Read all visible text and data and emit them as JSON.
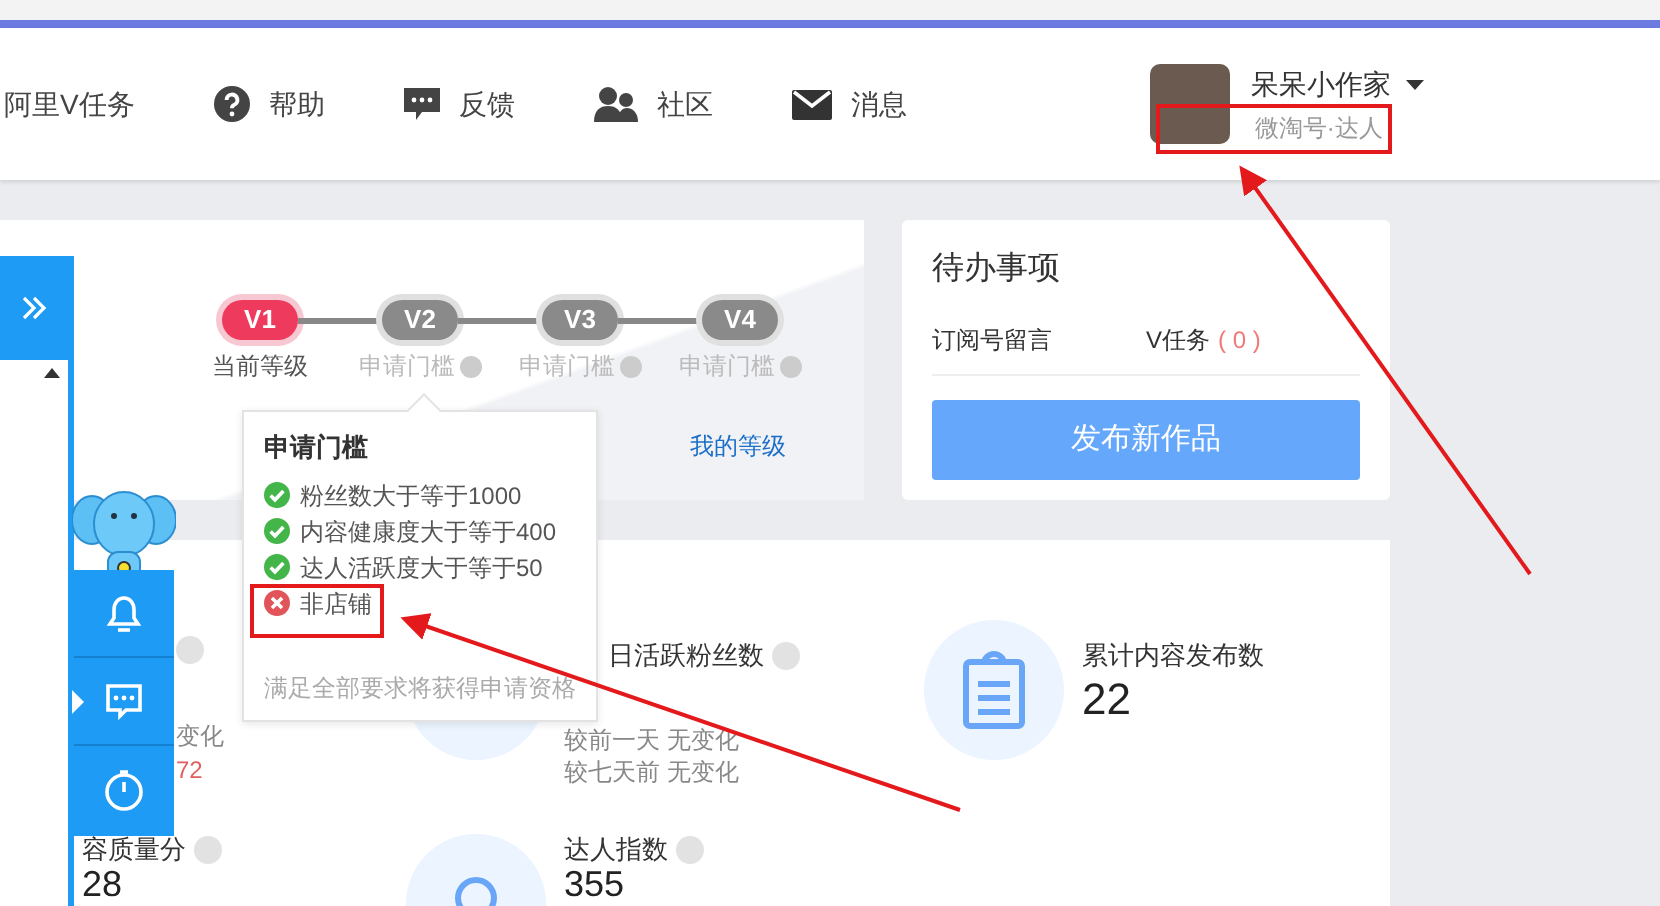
{
  "nav": {
    "items": [
      {
        "label": "阿里V任务"
      },
      {
        "label": "帮助"
      },
      {
        "label": "反馈"
      },
      {
        "label": "社区"
      },
      {
        "label": "消息"
      }
    ]
  },
  "user": {
    "name": "呆呆小作家",
    "role": "微淘号·达人"
  },
  "levels": {
    "steps": [
      {
        "badge": "V1",
        "label": "当前等级",
        "current": true
      },
      {
        "badge": "V2",
        "label": "申请门槛",
        "current": false
      },
      {
        "badge": "V3",
        "label": "申请门槛",
        "current": false
      },
      {
        "badge": "V4",
        "label": "申请门槛",
        "current": false
      }
    ],
    "link": "我的等级"
  },
  "popup": {
    "title": "申请门槛",
    "requirements": [
      {
        "text": "粉丝数大于等于1000",
        "met": true
      },
      {
        "text": "内容健康度大于等于400",
        "met": true
      },
      {
        "text": "达人活跃度大于等于50",
        "met": true
      },
      {
        "text": "非店铺",
        "met": false
      }
    ],
    "note": "满足全部要求将获得申请资格"
  },
  "todo": {
    "title": "待办事项",
    "items": [
      {
        "label": "订阅号留言"
      },
      {
        "label": "V任务",
        "count": "( 0 )"
      }
    ],
    "button": "发布新作品"
  },
  "stats": [
    {
      "kind": "clipped",
      "help": true,
      "lines": [
        "变化"
      ],
      "delta": "72"
    },
    {
      "kind": "full",
      "label": "日活跃粉丝数",
      "help": true,
      "lines": [
        "较前一天 无变化",
        "较七天前 无变化"
      ]
    },
    {
      "kind": "full",
      "label": "累计内容发布数",
      "help": false,
      "value": "22"
    },
    {
      "kind": "clipped",
      "label": "容质量分",
      "help": true,
      "value": "28"
    },
    {
      "kind": "full",
      "label": "达人指数",
      "help": true,
      "value": "355"
    }
  ]
}
